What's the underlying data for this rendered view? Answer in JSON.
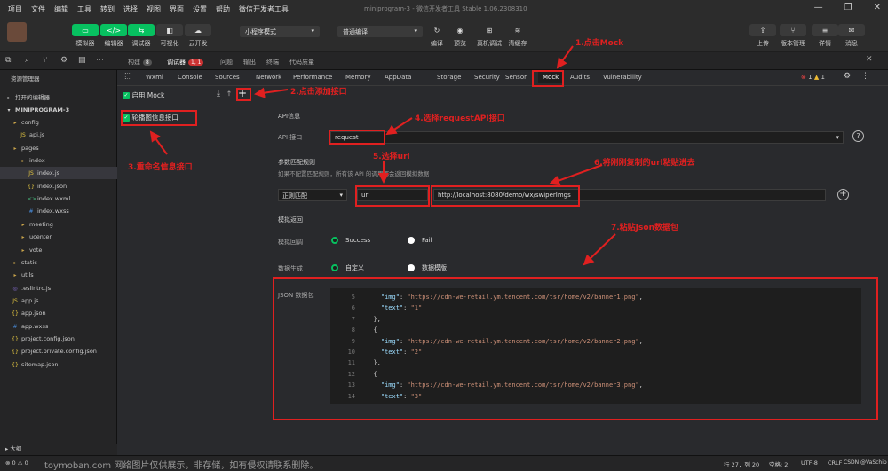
{
  "menu": [
    "项目",
    "文件",
    "编辑",
    "工具",
    "转到",
    "选择",
    "视图",
    "界面",
    "设置",
    "帮助",
    "微信开发者工具"
  ],
  "window_title": "miniprogram-3 - 微信开发者工具 Stable 1.06.2308310",
  "toolbar": {
    "left_buttons": [
      {
        "label": "模拟器",
        "icon": "phone-icon"
      },
      {
        "label": "编辑器",
        "icon": "code-icon"
      },
      {
        "label": "调试器",
        "icon": "debug-icon"
      },
      {
        "label": "可视化",
        "icon": "visual-icon"
      },
      {
        "label": "云开发",
        "icon": "cloud-icon"
      }
    ],
    "mode_select": "小程序模式",
    "compile_select": "普通编译",
    "mid_buttons": [
      "编译",
      "预览",
      "真机调试",
      "清缓存"
    ],
    "right_buttons": [
      "上传",
      "版本管理",
      "详情",
      "消息"
    ]
  },
  "panel_tabs": {
    "build": "构建",
    "build_count": "8",
    "debugger": "调试器",
    "debugger_badge": "1, 1",
    "issues": "问题",
    "output": "输出",
    "terminal": "终端",
    "code_quality": "代码质量"
  },
  "sidebar": {
    "title": "资源管理器",
    "open_editors": "打开的编辑器",
    "project": "MINIPROGRAM-3",
    "tree": [
      {
        "label": "config",
        "icon": "folder-icon",
        "indent": 1
      },
      {
        "label": "api.js",
        "icon": "js-file-icon",
        "indent": 2
      },
      {
        "label": "pages",
        "icon": "folder-icon",
        "indent": 1
      },
      {
        "label": "index",
        "icon": "folder-icon",
        "indent": 2
      },
      {
        "label": "index.js",
        "icon": "js-file-icon",
        "indent": 3,
        "selected": true
      },
      {
        "label": "index.json",
        "icon": "json-file-icon",
        "indent": 3
      },
      {
        "label": "index.wxml",
        "icon": "wxml-file-icon",
        "indent": 3
      },
      {
        "label": "index.wxss",
        "icon": "wxss-file-icon",
        "indent": 3
      },
      {
        "label": "meeting",
        "icon": "folder-icon",
        "indent": 2
      },
      {
        "label": "ucenter",
        "icon": "folder-icon",
        "indent": 2
      },
      {
        "label": "vote",
        "icon": "folder-icon",
        "indent": 2
      },
      {
        "label": "static",
        "icon": "folder-icon",
        "indent": 1
      },
      {
        "label": "utils",
        "icon": "folder-icon",
        "indent": 1
      },
      {
        "label": ".eslintrc.js",
        "icon": "eslint-file-icon",
        "indent": 1
      },
      {
        "label": "app.js",
        "icon": "js-file-icon",
        "indent": 1
      },
      {
        "label": "app.json",
        "icon": "json-file-icon",
        "indent": 1
      },
      {
        "label": "app.wxss",
        "icon": "wxss-file-icon",
        "indent": 1
      },
      {
        "label": "project.config.json",
        "icon": "json-file-icon",
        "indent": 1
      },
      {
        "label": "project.private.config.json",
        "icon": "json-file-icon",
        "indent": 1
      },
      {
        "label": "sitemap.json",
        "icon": "json-file-icon",
        "indent": 1
      }
    ],
    "outline": "大纲"
  },
  "devtools_tabs": [
    "Wxml",
    "Console",
    "Sources",
    "Network",
    "Performance",
    "Memory",
    "AppData",
    "Storage",
    "Security",
    "Sensor",
    "Mock",
    "Audits",
    "Vulnerability"
  ],
  "devtools_status": {
    "errors": "1",
    "warnings": "1"
  },
  "mock": {
    "enable_label": "启用 Mock",
    "rule_name": "轮播图信息接口",
    "api_section": "API信息",
    "api_label": "API 接口",
    "api_value": "request",
    "param_section": "参数匹配规则",
    "param_hint": "如果不配置匹配规则，所有该 API 的调用都会返回模拟数据",
    "match_type": "正则匹配",
    "key_value": "url",
    "url_value": "http://localhost:8080/demo/wx/swiperImgs",
    "mock_section": "模拟返回",
    "callback_label": "模拟回调",
    "success": "Success",
    "fail": "Fail",
    "gen_label": "数据生成",
    "custom": "自定义",
    "template": "数据模版",
    "json_label": "JSON 数据包"
  },
  "code_lines": [
    {
      "n": "5",
      "key": "\"img\"",
      "val": "\"https://cdn-we-retail.ym.tencent.com/tsr/home/v2/banner1.png\"",
      "tail": ","
    },
    {
      "n": "6",
      "key": "\"text\"",
      "val": "\"1\"",
      "tail": ""
    },
    {
      "n": "7",
      "plain": "},"
    },
    {
      "n": "8",
      "plain": "{"
    },
    {
      "n": "9",
      "key": "\"img\"",
      "val": "\"https://cdn-we-retail.ym.tencent.com/tsr/home/v2/banner2.png\"",
      "tail": ","
    },
    {
      "n": "10",
      "key": "\"text\"",
      "val": "\"2\"",
      "tail": ""
    },
    {
      "n": "11",
      "plain": "},"
    },
    {
      "n": "12",
      "plain": "{"
    },
    {
      "n": "13",
      "key": "\"img\"",
      "val": "\"https://cdn-we-retail.ym.tencent.com/tsr/home/v2/banner3.png\"",
      "tail": ","
    },
    {
      "n": "14",
      "key": "\"text\"",
      "val": "\"3\"",
      "tail": ""
    }
  ],
  "annotations": [
    "1.点击Mock",
    "2.点击添加接口",
    "3.重命名信息接口",
    "4.选择requestAPI接口",
    "5.选择url",
    "6.将刚刚复制的url粘贴进去",
    "7.粘贴Json数据包"
  ],
  "statusbar": {
    "errors": "0",
    "warnings": "0",
    "position": "行 27，列 20",
    "spaces": "空格: 2",
    "encoding": "UTF-8",
    "eol": "CRLF",
    "lang": "JavaScript"
  },
  "watermark": "toymoban.com 网络图片仅供展示，非存储，如有侵权请联系删除。",
  "csdn_mark": "CSDN @VaSchip"
}
